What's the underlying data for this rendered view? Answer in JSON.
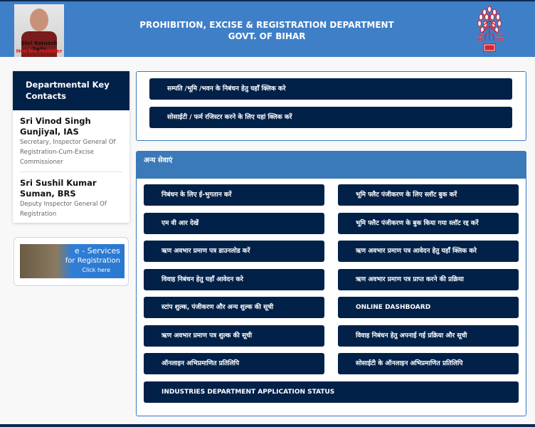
{
  "header": {
    "title_line1": "PROHIBITION, EXCISE & REGISTRATION DEPARTMENT",
    "title_line2": "GOVT. OF BIHAR",
    "photo_caption_name": "Shri Ratnesh Sada",
    "photo_caption_role": "Hon'ble Minister",
    "logo_text": "बिहार"
  },
  "sidebar": {
    "title": "Departmental Key Contacts",
    "contacts": [
      {
        "name": "Sri Vinod Singh Gunjiyal, IAS",
        "role": "Secretary, Inspector General Of Registration-Cum-Excise Commissioner"
      },
      {
        "name": "Sri Sushil Kumar Suman, BRS",
        "role": "Deputy Inspector General Of Registration"
      }
    ],
    "banner": {
      "line1": "e - Services",
      "line2": "for Registration",
      "line3": "Click here"
    }
  },
  "top_links": [
    "सम्पति /भूमि /भवन के निबंधन हेतु यहाँ क्लिक करे",
    "सोसाईटी / फर्म रजिस्टर करने के लिए यहां क्लिक करें"
  ],
  "other_services": {
    "title": "अन्य सेवाएं",
    "items": [
      "निबंधन के लिए ई-भुगतान करें",
      "भूमि फ्लैट पंजीकरण के लिए स्लॉट बुक करें",
      "एम वी आर देखें",
      "भूमि फ्लैट पंजीकरण के बुक किया गया स्लॉट रद्द करें",
      "ऋण अवभार प्रमाण पत्र डाउनलोड करें",
      "ऋण अवभार प्रमाण पत्र आवेदन हेतु यहाँ क्लिक करे",
      "विवाह निबंधन हेतु यहाँ आवेदन करे",
      "ऋण अवभार प्रमाण पत्र प्राप्त करने की प्रक्रिया",
      "स्टांप शुल्क, पंजीकरण और अन्य शुल्क की सूची",
      "ONLINE DASHBOARD",
      "ऋण अवभार प्रमाण पत्र शुल्क की सूची",
      "विवाह निबंधन हेतु अपनाई गई प्रक्रिया और सूची",
      "ऑनलाइन अभिप्रमाणित प्रतिलिपि",
      "सोसाईटी के ऑनलाइन अभिप्रमाणित प्रतिलिपि",
      "INDUSTRIES DEPARTMENT APPLICATION STATUS"
    ]
  },
  "colors": {
    "header": "#3f7fc8",
    "navy": "#012149",
    "panel_header": "#3a7ab8",
    "logo_red": "#d0283a"
  }
}
